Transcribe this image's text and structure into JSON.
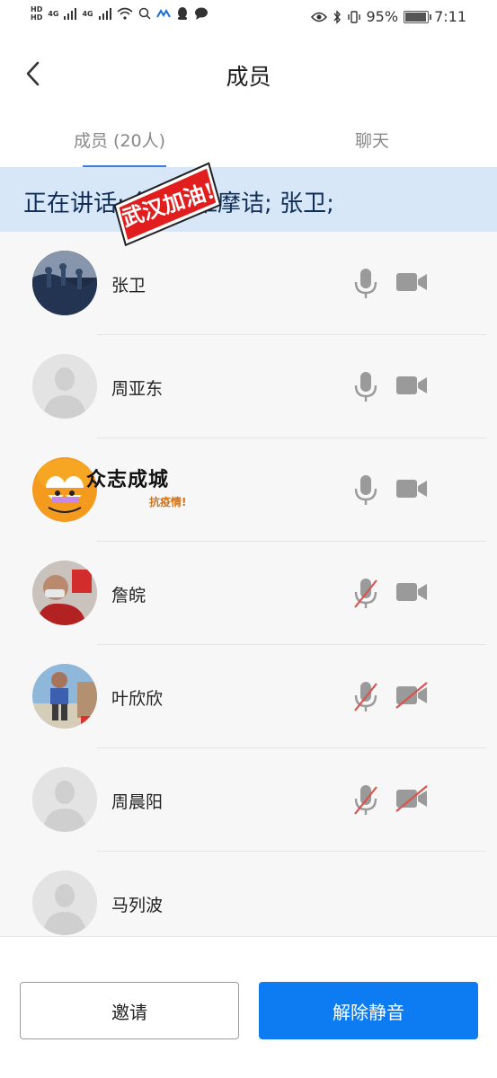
{
  "status_bar": {
    "battery_percent": "95%",
    "time": "7:11",
    "network_labels": [
      "HD",
      "4G",
      "4G"
    ]
  },
  "header": {
    "title": "成员"
  },
  "tabs": [
    {
      "label": "成员 (20人)",
      "active": true
    },
    {
      "label": "聊天",
      "active": false
    }
  ],
  "speaking_banner": {
    "text": "正在讲话: 詹皖; 维摩诘; 张卫;"
  },
  "sticker": {
    "text": "武汉加油!"
  },
  "members": [
    {
      "name": "张卫",
      "mic": "on",
      "camera": "on",
      "avatar": "photo-dark"
    },
    {
      "name": "周亚东",
      "mic": "on",
      "camera": "on",
      "avatar": "default"
    },
    {
      "name": "",
      "mic": "on",
      "camera": "on",
      "avatar": "cartoon",
      "overlay_main": "众志成城",
      "overlay_sub": "抗疫情!"
    },
    {
      "name": "詹皖",
      "mic": "off",
      "camera": "on",
      "avatar": "photo-red"
    },
    {
      "name": "叶欣欣",
      "mic": "off",
      "camera": "off",
      "avatar": "photo-child"
    },
    {
      "name": "周晨阳",
      "mic": "off",
      "camera": "off",
      "avatar": "default"
    },
    {
      "name": "马列波",
      "mic": "none",
      "camera": "none",
      "avatar": "default"
    }
  ],
  "buttons": {
    "invite": "邀请",
    "unmute": "解除静音"
  },
  "colors": {
    "accent": "#0d7cf2",
    "tab_indicator": "#3b7de0",
    "banner_bg": "#d7e7f7",
    "muted_slash": "#d9534f",
    "icon_gray": "#9a9a9a"
  }
}
